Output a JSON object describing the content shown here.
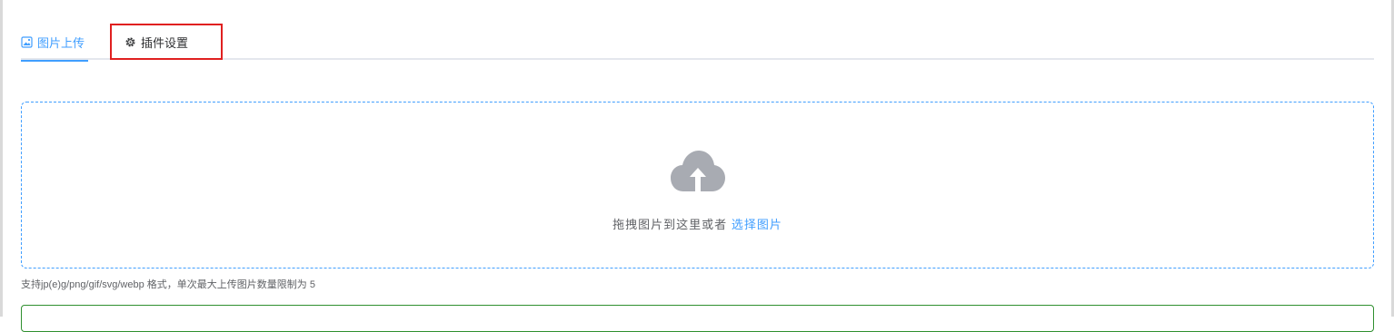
{
  "tabs": [
    {
      "label": "图片上传",
      "icon": "image-upload-icon",
      "active": true
    },
    {
      "label": "插件设置",
      "icon": "gear-icon",
      "active": false
    }
  ],
  "upload": {
    "icon": "cloud-upload-icon",
    "prompt": "拖拽图片到这里或者",
    "link": "选择图片"
  },
  "tip": "支持jp(e)g/png/gif/svg/webp 格式，单次最大上传图片数量限制为 5",
  "colors": {
    "accent": "#409eff",
    "highlight_border": "#e02020",
    "success_border": "#2f8f2f",
    "icon_gray": "#a8abb2"
  }
}
